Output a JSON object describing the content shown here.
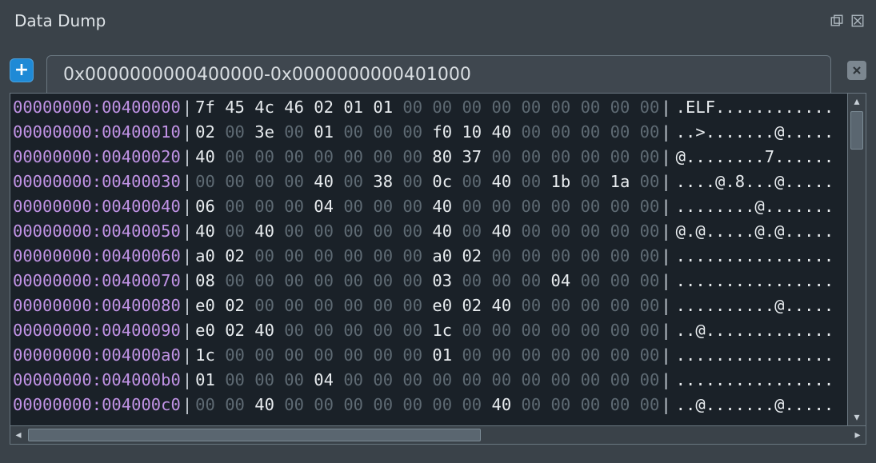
{
  "window": {
    "title": "Data Dump"
  },
  "toolbar": {
    "add_label": "+"
  },
  "tab": {
    "label": "0x0000000000400000-0x0000000000401000"
  },
  "hex": {
    "rows": [
      {
        "addr": "00000000:00400000",
        "bytes": [
          "7f",
          "45",
          "4c",
          "46",
          "02",
          "01",
          "01",
          "00",
          "00",
          "00",
          "00",
          "00",
          "00",
          "00",
          "00",
          "00"
        ],
        "ascii": ".ELF............"
      },
      {
        "addr": "00000000:00400010",
        "bytes": [
          "02",
          "00",
          "3e",
          "00",
          "01",
          "00",
          "00",
          "00",
          "f0",
          "10",
          "40",
          "00",
          "00",
          "00",
          "00",
          "00"
        ],
        "ascii": "..>.......@....."
      },
      {
        "addr": "00000000:00400020",
        "bytes": [
          "40",
          "00",
          "00",
          "00",
          "00",
          "00",
          "00",
          "00",
          "80",
          "37",
          "00",
          "00",
          "00",
          "00",
          "00",
          "00"
        ],
        "ascii": "@........7......"
      },
      {
        "addr": "00000000:00400030",
        "bytes": [
          "00",
          "00",
          "00",
          "00",
          "40",
          "00",
          "38",
          "00",
          "0c",
          "00",
          "40",
          "00",
          "1b",
          "00",
          "1a",
          "00"
        ],
        "ascii": "....@.8...@....."
      },
      {
        "addr": "00000000:00400040",
        "bytes": [
          "06",
          "00",
          "00",
          "00",
          "04",
          "00",
          "00",
          "00",
          "40",
          "00",
          "00",
          "00",
          "00",
          "00",
          "00",
          "00"
        ],
        "ascii": "........@......."
      },
      {
        "addr": "00000000:00400050",
        "bytes": [
          "40",
          "00",
          "40",
          "00",
          "00",
          "00",
          "00",
          "00",
          "40",
          "00",
          "40",
          "00",
          "00",
          "00",
          "00",
          "00"
        ],
        "ascii": "@.@.....@.@....."
      },
      {
        "addr": "00000000:00400060",
        "bytes": [
          "a0",
          "02",
          "00",
          "00",
          "00",
          "00",
          "00",
          "00",
          "a0",
          "02",
          "00",
          "00",
          "00",
          "00",
          "00",
          "00"
        ],
        "ascii": "................"
      },
      {
        "addr": "00000000:00400070",
        "bytes": [
          "08",
          "00",
          "00",
          "00",
          "00",
          "00",
          "00",
          "00",
          "03",
          "00",
          "00",
          "00",
          "04",
          "00",
          "00",
          "00"
        ],
        "ascii": "................"
      },
      {
        "addr": "00000000:00400080",
        "bytes": [
          "e0",
          "02",
          "00",
          "00",
          "00",
          "00",
          "00",
          "00",
          "e0",
          "02",
          "40",
          "00",
          "00",
          "00",
          "00",
          "00"
        ],
        "ascii": "..........@....."
      },
      {
        "addr": "00000000:00400090",
        "bytes": [
          "e0",
          "02",
          "40",
          "00",
          "00",
          "00",
          "00",
          "00",
          "1c",
          "00",
          "00",
          "00",
          "00",
          "00",
          "00",
          "00"
        ],
        "ascii": "..@............."
      },
      {
        "addr": "00000000:004000a0",
        "bytes": [
          "1c",
          "00",
          "00",
          "00",
          "00",
          "00",
          "00",
          "00",
          "01",
          "00",
          "00",
          "00",
          "00",
          "00",
          "00",
          "00"
        ],
        "ascii": "................"
      },
      {
        "addr": "00000000:004000b0",
        "bytes": [
          "01",
          "00",
          "00",
          "00",
          "04",
          "00",
          "00",
          "00",
          "00",
          "00",
          "00",
          "00",
          "00",
          "00",
          "00",
          "00"
        ],
        "ascii": "................"
      },
      {
        "addr": "00000000:004000c0",
        "bytes": [
          "00",
          "00",
          "40",
          "00",
          "00",
          "00",
          "00",
          "00",
          "00",
          "00",
          "40",
          "00",
          "00",
          "00",
          "00",
          "00"
        ],
        "ascii": "..@.......@....."
      }
    ]
  }
}
